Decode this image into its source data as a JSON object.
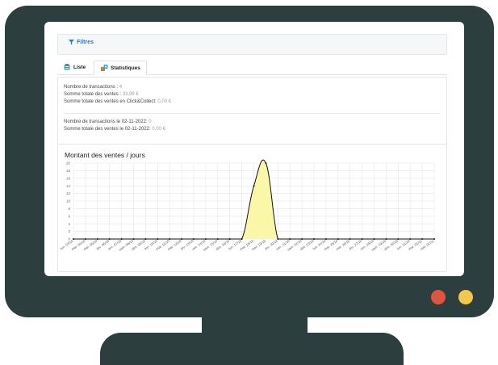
{
  "filters": {
    "label": "Filtres"
  },
  "tabs": [
    {
      "label": "Liste",
      "icon": "list-icon"
    },
    {
      "label": "Statistiques",
      "icon": "stats-icon"
    }
  ],
  "stats": {
    "nb_transactions_label": "Nombre de transactions : ",
    "nb_transactions_value": "4",
    "somme_ventes_label": "Somme totale des ventes : ",
    "somme_ventes_value": "33,99 €",
    "somme_click_label": "Somme totale des ventes en Click&Collect: ",
    "somme_click_value": "0,00 €",
    "nb_transactions_date_label": "Nombre de transactions le 02-11-2022: ",
    "nb_transactions_date_value": "0",
    "somme_date_label": "Somme totale des ventes le 02-11-2022: ",
    "somme_date_value": "0,00 €"
  },
  "chart_data": {
    "type": "area",
    "title": "Montant des ventes / jours",
    "xlabel": "",
    "ylabel": "",
    "ylim": [
      0,
      20
    ],
    "yticks": [
      0,
      2,
      4,
      6,
      8,
      10,
      12,
      14,
      16,
      18,
      20
    ],
    "grid": true,
    "fill_color": "#fbf7a8",
    "line_color": "#111111",
    "categories": [
      "lun. 03/10",
      "mar. 04/10",
      "mer. 05/10",
      "jeu. 06/10",
      "ven. 07/10",
      "sam. 08/10",
      "dim. 09/10",
      "lun. 10/10",
      "mar. 11/10",
      "mer. 12/10",
      "jeu. 13/10",
      "ven. 14/10",
      "sam. 15/10",
      "dim. 16/10",
      "lun. 17/10",
      "mar. 18/10",
      "mer. 19/10",
      "jeu. 20/10",
      "ven. 21/10",
      "sam. 22/10",
      "dim. 23/10",
      "lun. 24/10",
      "mar. 25/10",
      "mer. 26/10",
      "jeu. 27/10",
      "ven. 28/10",
      "sam. 29/10",
      "dim. 30/10",
      "lun. 31/10",
      "mar. 01/11",
      "mer. 02/11"
    ],
    "values": [
      0,
      0,
      0,
      0,
      0,
      0,
      0,
      0,
      0,
      0,
      0,
      0,
      0,
      0,
      0,
      14,
      20,
      0,
      0,
      0,
      0,
      0,
      0,
      0,
      0,
      0,
      0,
      0,
      0,
      0,
      0
    ]
  }
}
